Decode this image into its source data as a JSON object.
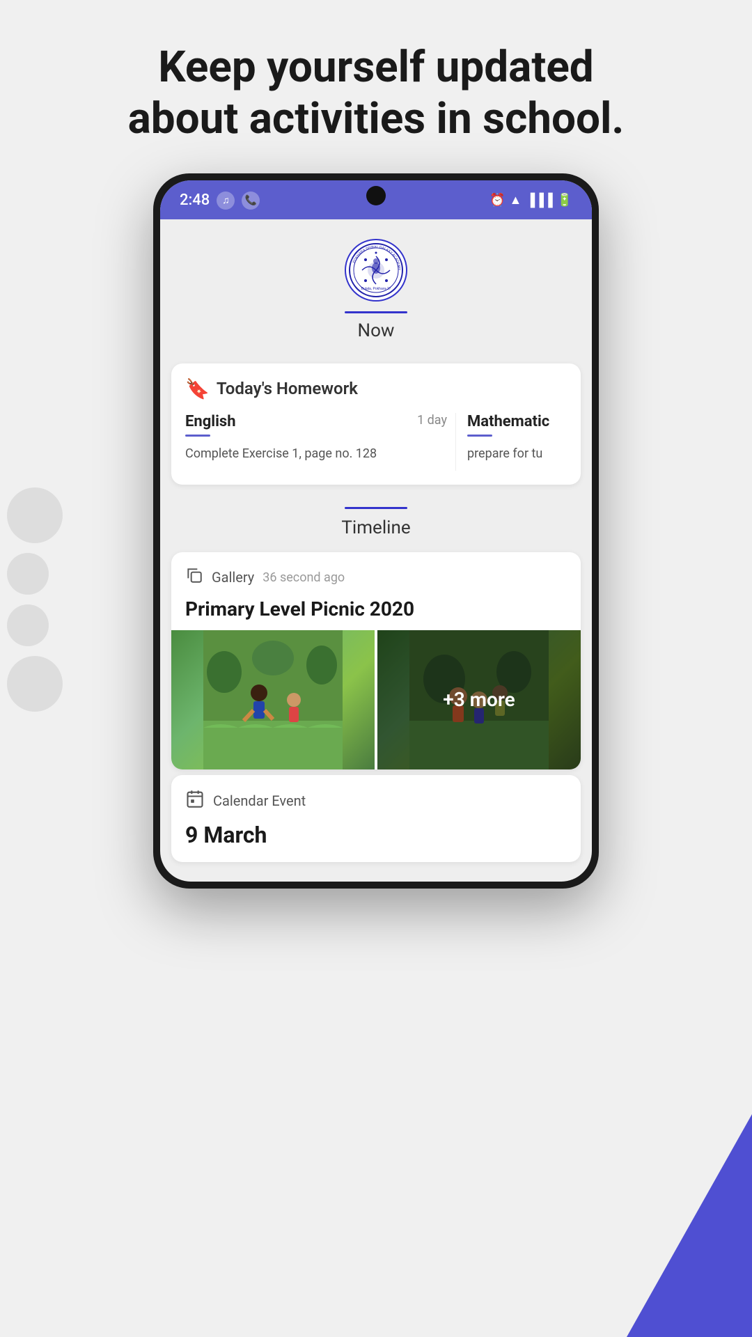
{
  "page": {
    "headline_line1": "Keep yourself updated",
    "headline_line2": "about activities in school."
  },
  "status_bar": {
    "time": "2:48",
    "icons_left": [
      "music-note",
      "phone"
    ],
    "icons_right": [
      "alarm",
      "wifi",
      "signal",
      "battery"
    ]
  },
  "app_header": {
    "tab_label": "Now",
    "logo_alt": "School Logo"
  },
  "homework": {
    "section_title": "Today's Homework",
    "subjects": [
      {
        "name": "English",
        "days": "1 day",
        "description": "Complete Exercise 1, page no. 128"
      },
      {
        "name": "Mathematic",
        "days": "",
        "description": "prepare for tu"
      }
    ]
  },
  "timeline": {
    "label": "Timeline"
  },
  "gallery_post": {
    "type": "Gallery",
    "time_ago": "36 second ago",
    "title": "Primary Level Picnic 2020",
    "more_count": "+3 more"
  },
  "calendar_event": {
    "type": "Calendar Event",
    "date": "9 March"
  }
}
